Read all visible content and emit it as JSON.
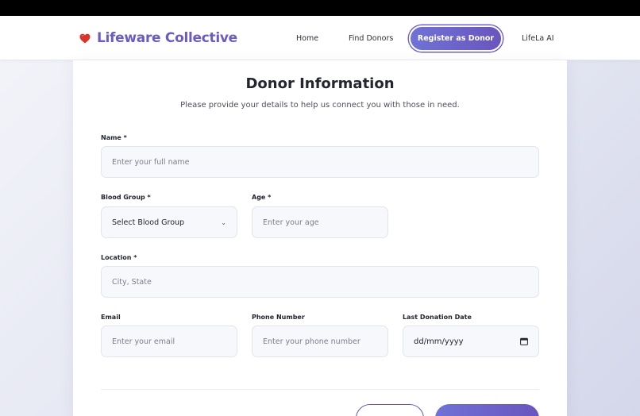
{
  "brand": {
    "name": "Lifeware Collective",
    "logo_icon": "heart-icon",
    "logo_color": "#d9342b",
    "text_color": "#6b5bc2"
  },
  "nav": {
    "home": "Home",
    "find_donors": "Find Donors",
    "register": "Register as Donor",
    "ai": "LifeLa AI"
  },
  "form": {
    "title": "Donor Information",
    "subtitle": "Please provide your details to help us connect you with those in need.",
    "name": {
      "label": "Name *",
      "placeholder": "Enter your full name"
    },
    "blood_group": {
      "label": "Blood Group *",
      "value": "Select Blood Group"
    },
    "age": {
      "label": "Age *",
      "placeholder": "Enter your age"
    },
    "location": {
      "label": "Location *",
      "placeholder": "City, State"
    },
    "email": {
      "label": "Email",
      "placeholder": "Enter your email"
    },
    "phone": {
      "label": "Phone Number",
      "placeholder": "Enter your phone number"
    },
    "last_donation": {
      "label": "Last Donation Date",
      "value": "dd/mm/yyyy"
    }
  },
  "colors": {
    "accent_start": "#6f72d6",
    "accent_end": "#6a55be"
  }
}
